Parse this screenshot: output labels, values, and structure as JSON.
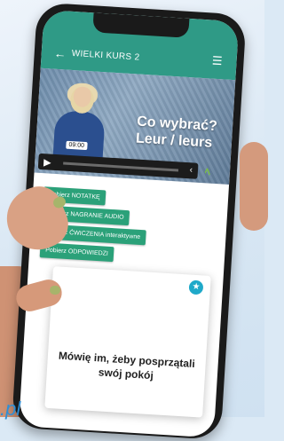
{
  "app": {
    "back_icon": "arrow-left-icon",
    "title": "WIELKI KURS 2",
    "menu_icon": "hamburger-menu-icon"
  },
  "video": {
    "title_line1": "Co wybrać?",
    "title_line2": "Leur / leurs",
    "time": "09:00",
    "progress": 0.0
  },
  "downloads": [
    {
      "label": "Pobierz NOTATKĘ"
    },
    {
      "label": "Pobierz NAGRANIE AUDIO"
    },
    {
      "label": "Pobierz ĆWICZENIA interaktywne"
    },
    {
      "label": "Pobierz ODPOWIEDZI"
    }
  ],
  "flashcard": {
    "text": "Mówię im, żeby posprzątali swój pokój",
    "star_icon": "star-icon"
  },
  "website": {
    "text": ".pl"
  },
  "colors": {
    "appbar": "#2f9a86",
    "button": "#2ba179",
    "star": "#1fa9c9"
  }
}
